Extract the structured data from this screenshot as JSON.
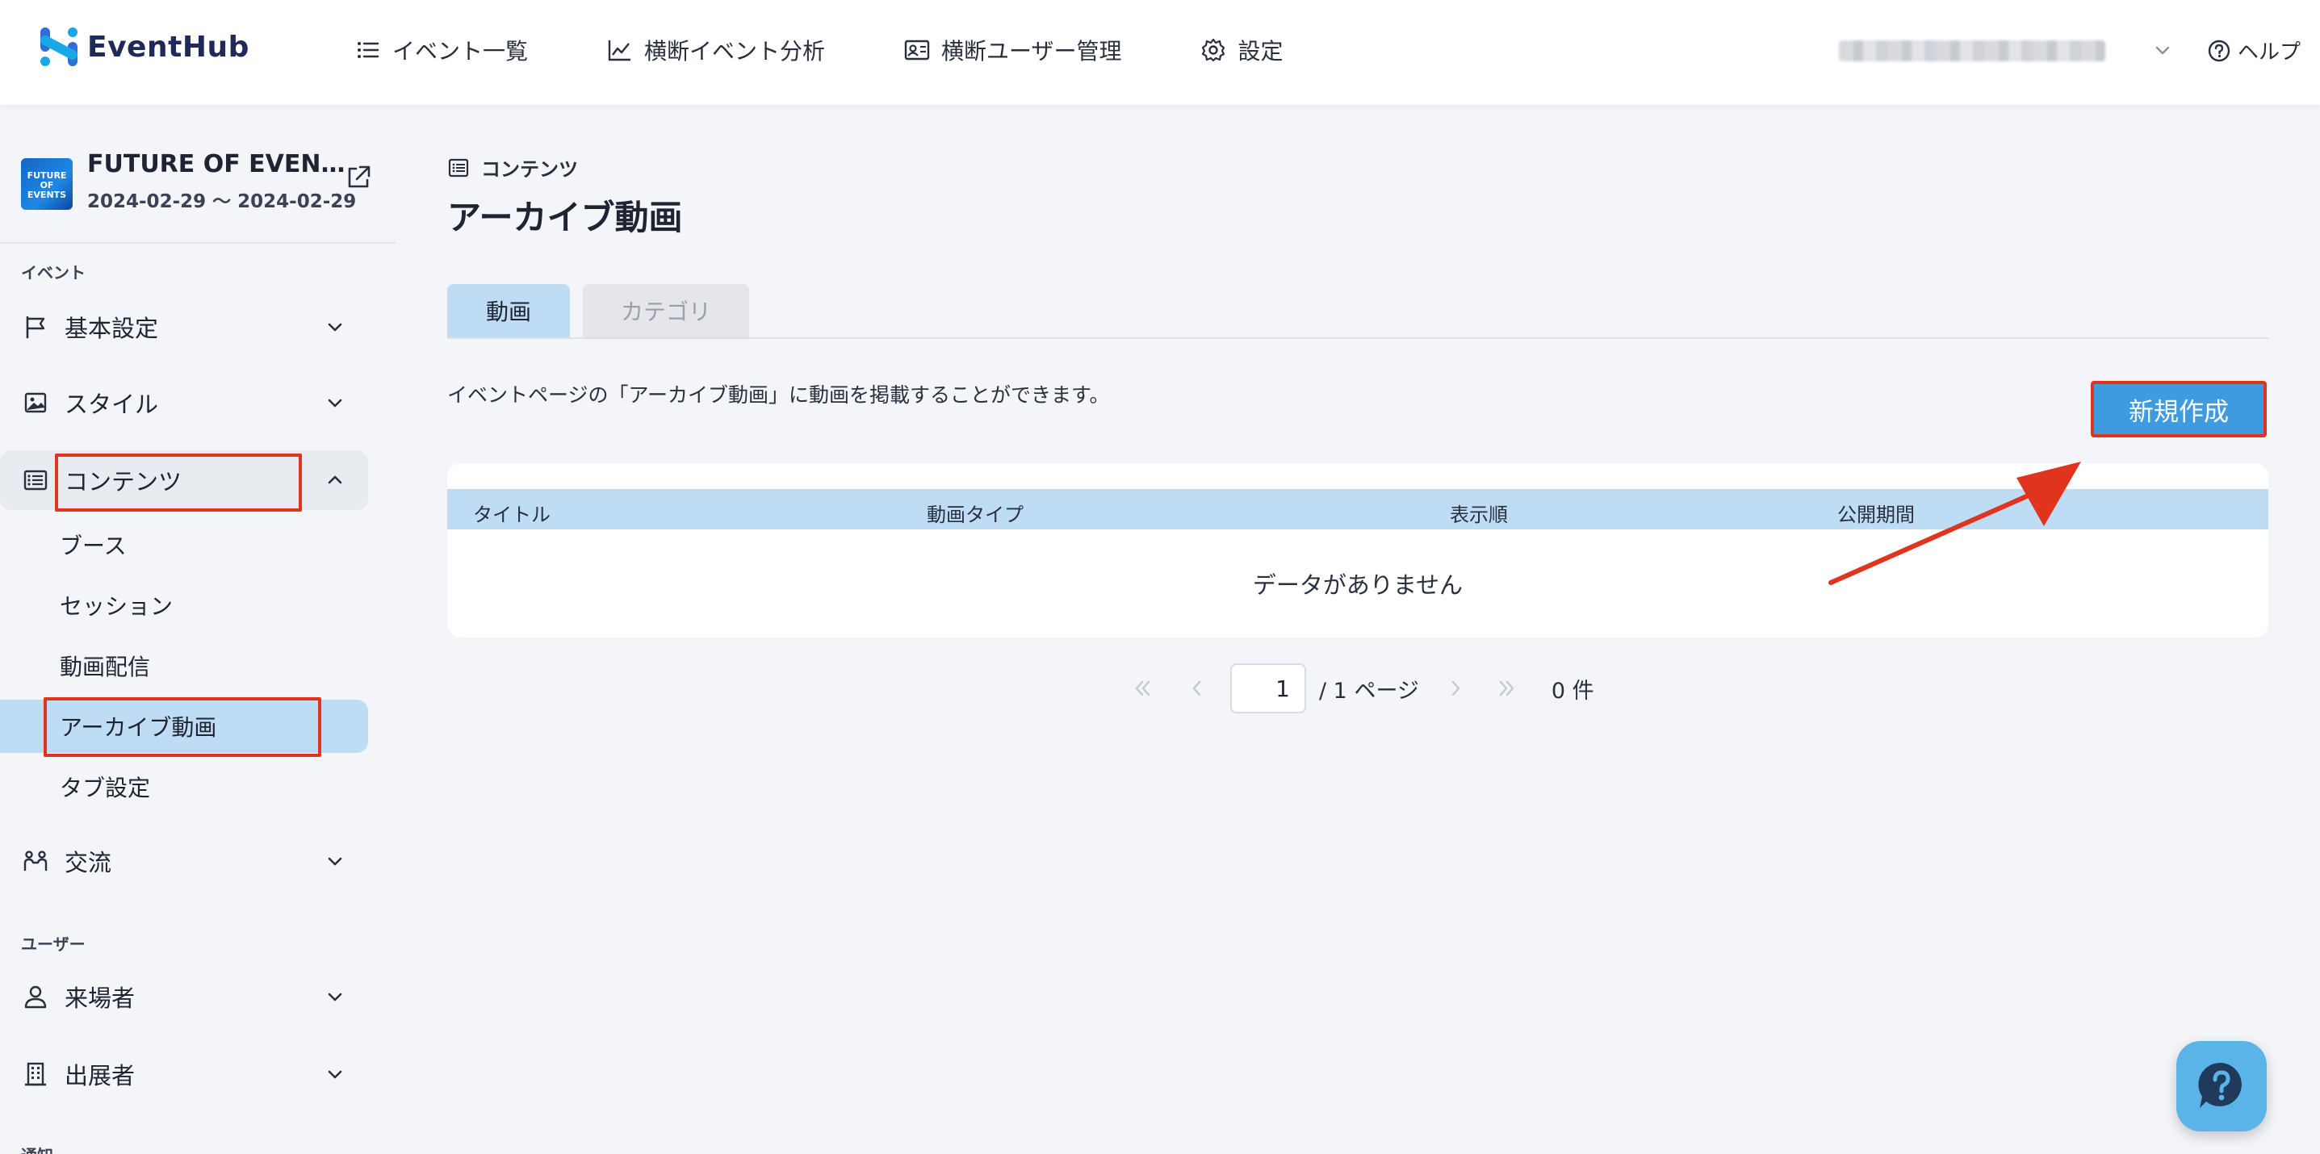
{
  "header": {
    "brand": "EventHub",
    "nav": [
      {
        "label": "イベント一覧",
        "icon": "list-icon"
      },
      {
        "label": "横断イベント分析",
        "icon": "chart-line-icon"
      },
      {
        "label": "横断ユーザー管理",
        "icon": "id-card-icon"
      },
      {
        "label": "設定",
        "icon": "gear-icon"
      }
    ],
    "help_label": "ヘルプ"
  },
  "event": {
    "title": "FUTURE OF EVEN…",
    "dates": "2024-02-29 ～ 2024-02-29",
    "thumb_text": "FUTURE OF EVENTS"
  },
  "sidebar": {
    "section_event": "イベント",
    "section_user": "ユーザー",
    "section_notify": "通知",
    "groups": [
      {
        "label": "基本設定",
        "icon": "flag-icon"
      },
      {
        "label": "スタイル",
        "icon": "image-icon"
      },
      {
        "label": "コンテンツ",
        "icon": "list-icon"
      },
      {
        "label": "交流",
        "icon": "people-icon"
      },
      {
        "label": "来場者",
        "icon": "user-icon"
      },
      {
        "label": "出展者",
        "icon": "building-icon"
      }
    ],
    "content_items": [
      {
        "label": "ブース"
      },
      {
        "label": "セッション"
      },
      {
        "label": "動画配信"
      },
      {
        "label": "アーカイブ動画"
      },
      {
        "label": "タブ設定"
      }
    ]
  },
  "main": {
    "breadcrumb": "コンテンツ",
    "title": "アーカイブ動画",
    "tabs": [
      {
        "label": "動画",
        "active": true
      },
      {
        "label": "カテゴリ",
        "active": false
      }
    ],
    "description": "イベントページの「アーカイブ動画」に動画を掲載することができます。",
    "new_button": "新規作成",
    "table": {
      "columns": [
        "タイトル",
        "動画タイプ",
        "表示順",
        "公開期間"
      ],
      "empty_text": "データがありません"
    },
    "pager": {
      "page_value": "1",
      "page_total": "/ 1 ページ",
      "count": "0 件"
    }
  },
  "colors": {
    "accent": "#3e9be0",
    "highlight": "#e0341e",
    "active_bg": "#bfdcf5"
  }
}
